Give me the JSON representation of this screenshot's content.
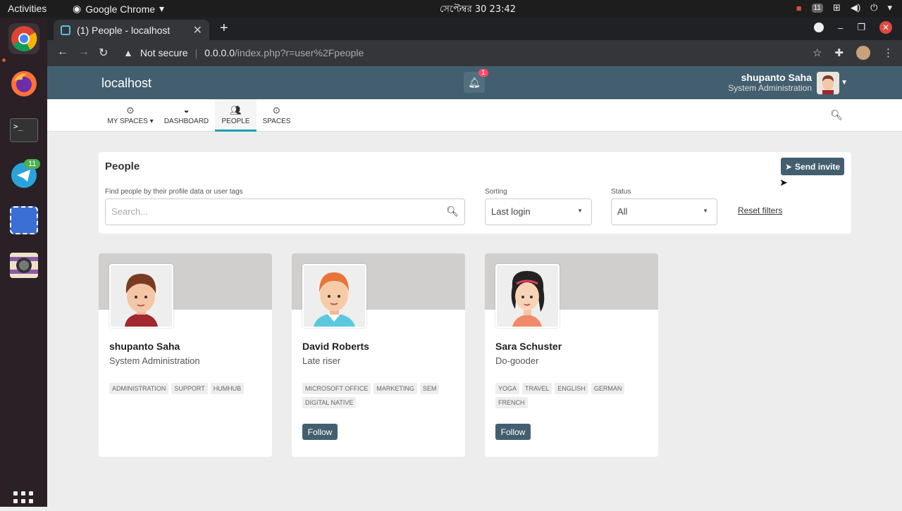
{
  "system": {
    "activities": "Activities",
    "app_menu": "Google Chrome",
    "clock": "সেপ্টেম্বর 30  23:42",
    "tray_badge": "11"
  },
  "dock": {
    "telegram_badge": "11"
  },
  "browser": {
    "tab_title": "(1) People - localhost",
    "security": "Not secure",
    "url_host": "0.0.0.0",
    "url_path": "/index.php?r=user%2Fpeople"
  },
  "header": {
    "brand": "localhost",
    "notification_count": "1",
    "user_name": "shupanto Saha",
    "user_role": "System Administration"
  },
  "nav": {
    "items": [
      {
        "label": "MY SPACES"
      },
      {
        "label": "DASHBOARD"
      },
      {
        "label": "PEOPLE"
      },
      {
        "label": "SPACES"
      }
    ]
  },
  "people": {
    "title": "People",
    "send_invite": "Send invite",
    "search_label": "Find people by their profile data or user tags",
    "search_placeholder": "Search...",
    "sorting_label": "Sorting",
    "sorting_value": "Last login",
    "status_label": "Status",
    "status_value": "All",
    "reset": "Reset filters"
  },
  "cards": [
    {
      "name": "shupanto Saha",
      "role": "System Administration",
      "tags": [
        "ADMINISTRATION",
        "SUPPORT",
        "HUMHUB"
      ]
    },
    {
      "name": "David Roberts",
      "role": "Late riser",
      "tags": [
        "MICROSOFT OFFICE",
        "MARKETING",
        "SEM",
        "DIGITAL NATIVE"
      ],
      "follow": "Follow"
    },
    {
      "name": "Sara Schuster",
      "role": "Do-gooder",
      "tags": [
        "YOGA",
        "TRAVEL",
        "ENGLISH",
        "GERMAN",
        "FRENCH"
      ],
      "follow": "Follow"
    }
  ]
}
